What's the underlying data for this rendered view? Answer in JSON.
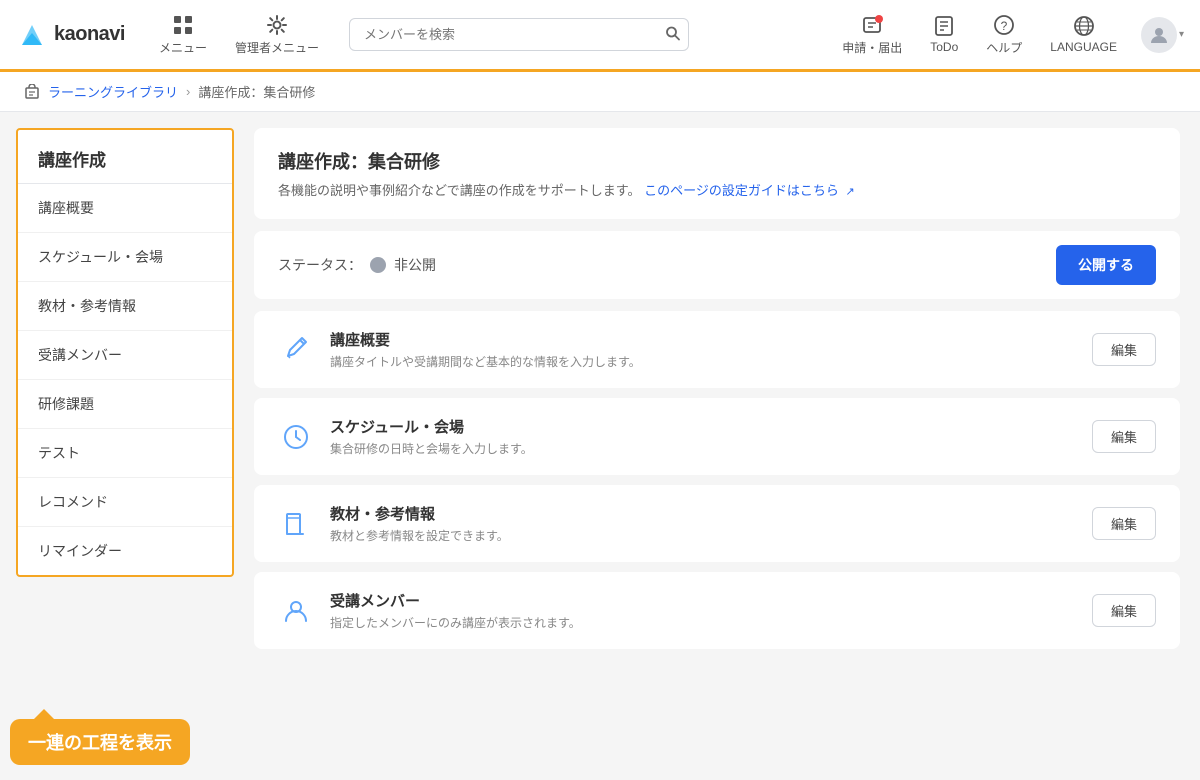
{
  "header": {
    "logo_text": "kaonavi",
    "menu_label": "メニュー",
    "admin_menu_label": "管理者メニュー",
    "search_placeholder": "メンバーを検索",
    "apply_label": "申請・届出",
    "todo_label": "ToDo",
    "help_label": "ヘルプ",
    "language_label": "LANGUAGE"
  },
  "breadcrumb": {
    "library_label": "ラーニングライブラリ",
    "separator": "›",
    "current": "講座作成：集合研修"
  },
  "sidebar": {
    "title": "講座作成",
    "items": [
      {
        "label": "講座概要"
      },
      {
        "label": "スケジュール・会場"
      },
      {
        "label": "教材・参考情報"
      },
      {
        "label": "受講メンバー"
      },
      {
        "label": "研修課題"
      },
      {
        "label": "テスト"
      },
      {
        "label": "レコメンド"
      },
      {
        "label": "リマインダー"
      }
    ],
    "tooltip": "一連の工程を表示"
  },
  "content": {
    "title": "講座作成：集合研修",
    "subtitle": "各機能の説明や事例紹介などで講座の作成をサポートします。",
    "guide_link": "このページの設定ガイドはこちら",
    "status_label": "ステータス：",
    "status_value": "非公開",
    "publish_btn": "公開する",
    "sections": [
      {
        "name": "講座概要",
        "desc": "講座タイトルや受講期間など基本的な情報を入力します。",
        "icon_type": "pencil",
        "edit_label": "編集"
      },
      {
        "name": "スケジュール・会場",
        "desc": "集合研修の日時と会場を入力します。",
        "icon_type": "clock",
        "edit_label": "編集"
      },
      {
        "name": "教材・参考情報",
        "desc": "教材と参考情報を設定できます。",
        "icon_type": "book",
        "edit_label": "編集"
      },
      {
        "name": "受講メンバー",
        "desc": "指定したメンバーにのみ講座が表示されます。",
        "icon_type": "person",
        "edit_label": "編集"
      }
    ]
  },
  "colors": {
    "orange": "#f5a623",
    "blue": "#2563eb",
    "border": "#e5e7eb",
    "sidebar_border": "#f5a623"
  }
}
